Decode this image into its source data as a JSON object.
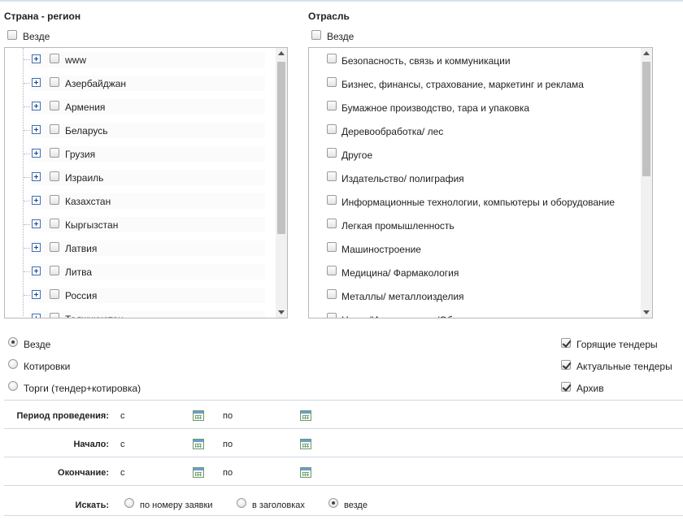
{
  "country": {
    "title": "Страна - регион",
    "everywhere_label": "Везде",
    "items": [
      "www",
      "Азербайджан",
      "Армения",
      "Беларусь",
      "Грузия",
      "Израиль",
      "Казахстан",
      "Кыргызстан",
      "Латвия",
      "Литва",
      "Россия",
      "Таджикистан"
    ]
  },
  "industry": {
    "title": "Отрасль",
    "everywhere_label": "Везде",
    "items": [
      "Безопасность, связь и коммуникации",
      "Бизнес, финансы, страхование, маркетинг и реклама",
      "Бумажное производство, тара и упаковка",
      "Деревообработка/ лес",
      "Другое",
      "Издательство/ полиграфия",
      "Информационные технологии, компьютеры и оборудование",
      "Легкая промышленность",
      "Машиностроение",
      "Медицина/ Фармакология",
      "Металлы/ металлоизделия",
      "Наука/Исследования/Образование"
    ]
  },
  "type_options": [
    {
      "label": "Везде",
      "selected": true
    },
    {
      "label": "Котировки",
      "selected": false
    },
    {
      "label": "Торги (тендер+котировка)",
      "selected": false
    }
  ],
  "status_options": [
    {
      "label": "Горящие тендеры",
      "checked": true
    },
    {
      "label": "Актуальные тендеры",
      "checked": true
    },
    {
      "label": "Архив",
      "checked": true
    }
  ],
  "periods": [
    {
      "label": "Период проведения:",
      "from": "с",
      "to": "по"
    },
    {
      "label": "Начало:",
      "from": "с",
      "to": "по"
    },
    {
      "label": "Окончание:",
      "from": "с",
      "to": "по"
    }
  ],
  "search": {
    "label": "Искать:",
    "options": [
      {
        "label": "по номеру заявки",
        "selected": false
      },
      {
        "label": "в заголовках",
        "selected": false
      },
      {
        "label": "везде",
        "selected": true
      }
    ]
  }
}
